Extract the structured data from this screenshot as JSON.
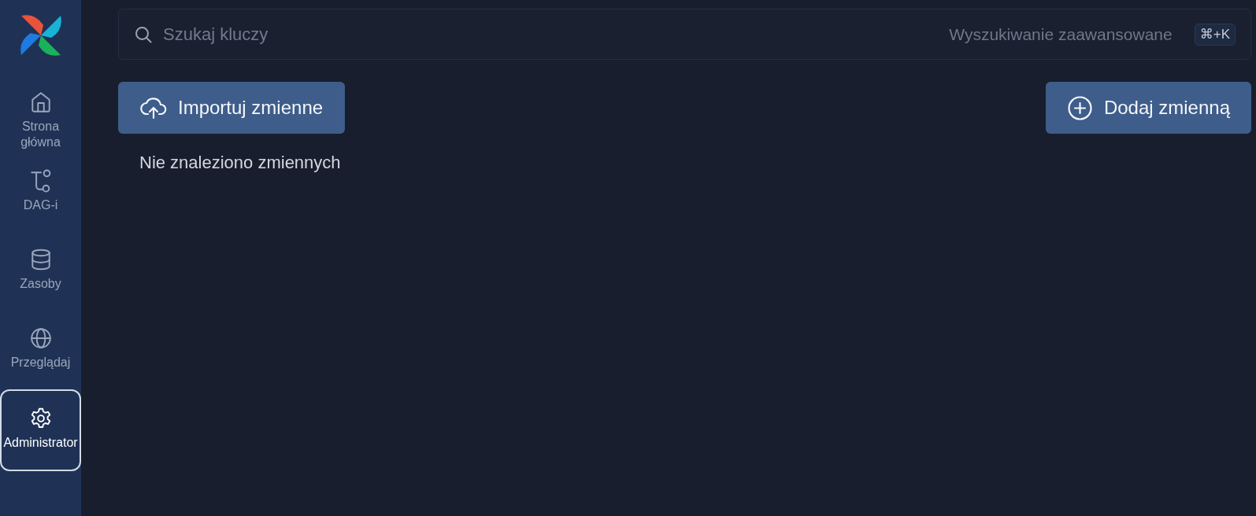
{
  "sidebar": {
    "items": [
      {
        "label": "Strona główna",
        "selected": false
      },
      {
        "label": "DAG-i",
        "selected": false
      },
      {
        "label": "Zasoby",
        "selected": false
      },
      {
        "label": "Przeglądaj",
        "selected": false
      },
      {
        "label": "Administrator",
        "selected": true
      }
    ]
  },
  "search": {
    "placeholder": "Szukaj kluczy",
    "advanced_link": "Wyszukiwanie zaawansowane",
    "shortcut": "⌘+K"
  },
  "toolbar": {
    "buttons": [
      {
        "kind": "import",
        "label": "Importuj zmienne"
      },
      {
        "kind": "add",
        "label": "Dodaj zmienną"
      }
    ]
  },
  "empty_message": "Nie znaleziono zmiennych"
}
